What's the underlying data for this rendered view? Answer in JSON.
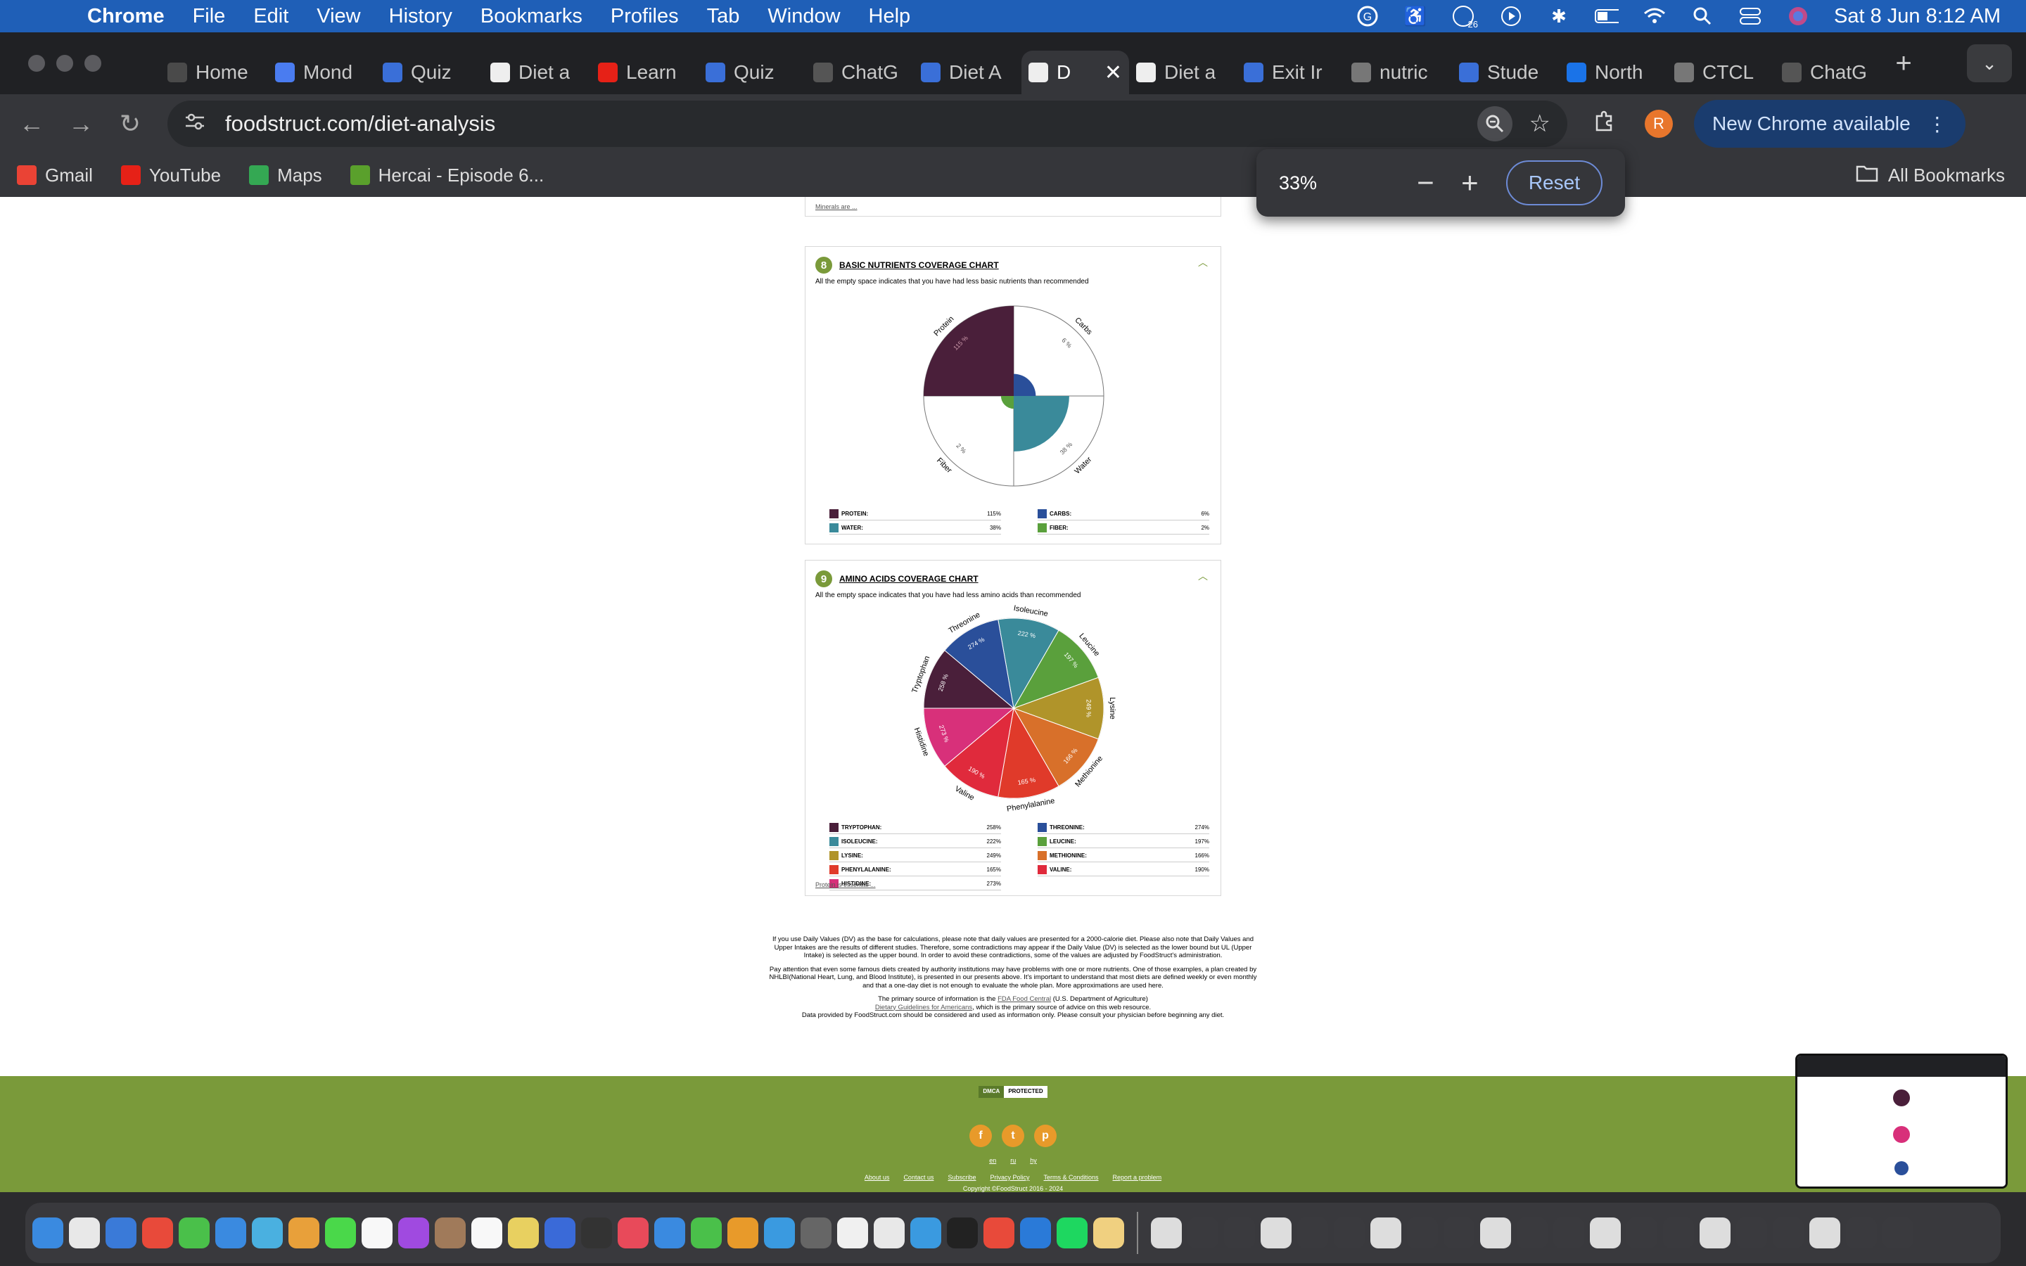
{
  "menubar": {
    "app": "Chrome",
    "items": [
      "File",
      "Edit",
      "View",
      "History",
      "Bookmarks",
      "Profiles",
      "Tab",
      "Window",
      "Help"
    ],
    "badge_count": "26",
    "datetime": "Sat 8 Jun  8:12 AM"
  },
  "tabs": [
    {
      "title": "Home",
      "color": "#4a4a4a",
      "icon": "home-icon",
      "active": false
    },
    {
      "title": "Mond",
      "color": "#4a7cf0",
      "icon": "docs-icon",
      "active": false
    },
    {
      "title": "Quiz",
      "color": "#3a6fd8",
      "icon": "quiz-icon",
      "active": false
    },
    {
      "title": "Diet a",
      "color": "#eeeeee",
      "icon": "foodstruct-icon",
      "active": false
    },
    {
      "title": "Learn",
      "color": "#e62117",
      "icon": "youtube-icon",
      "active": false
    },
    {
      "title": "Quiz",
      "color": "#3a6fd8",
      "icon": "quiz-icon",
      "active": false
    },
    {
      "title": "ChatG",
      "color": "#555555",
      "icon": "chatgpt-icon",
      "active": false
    },
    {
      "title": "Diet A",
      "color": "#3a6fd8",
      "icon": "quiz-icon",
      "active": false
    },
    {
      "title": "D",
      "color": "#eeeeee",
      "icon": "foodstruct-icon",
      "active": true
    },
    {
      "title": "Diet a",
      "color": "#eeeeee",
      "icon": "foodstruct-icon",
      "active": false
    },
    {
      "title": "Exit Ir",
      "color": "#3a6fd8",
      "icon": "quiz-icon",
      "active": false
    },
    {
      "title": "nutric",
      "color": "#777777",
      "icon": "globe-icon",
      "active": false
    },
    {
      "title": "Stude",
      "color": "#3a6fd8",
      "icon": "quiz-icon",
      "active": false
    },
    {
      "title": "North",
      "color": "#1a73e8",
      "icon": "loading-icon",
      "active": false
    },
    {
      "title": "CTCL",
      "color": "#777777",
      "icon": "globe-icon",
      "active": false
    },
    {
      "title": "ChatG",
      "color": "#555555",
      "icon": "chatgpt-icon",
      "active": false
    }
  ],
  "toolbar": {
    "url": "foodstruct.com/diet-analysis",
    "avatar_letter": "R",
    "new_chrome": "New Chrome available"
  },
  "bookmarks": [
    {
      "label": "Gmail",
      "icon": "gmail-icon",
      "color": "#ea4335"
    },
    {
      "label": "YouTube",
      "icon": "youtube-icon",
      "color": "#e62117"
    },
    {
      "label": "Maps",
      "icon": "maps-icon",
      "color": "#34a853"
    },
    {
      "label": "Hercai - Episode 6...",
      "icon": "play-icon",
      "color": "#5aa02c"
    }
  ],
  "all_bookmarks": "All Bookmarks",
  "zoom": {
    "value": "33%",
    "reset": "Reset"
  },
  "page": {
    "top_link": "Minerals are ...",
    "basic": {
      "number": "8",
      "title": "BASIC NUTRIENTS COVERAGE CHART",
      "subtitle": "All the empty space indicates that you have had less basic nutrients than recommended",
      "legend": [
        {
          "name": "PROTEIN:",
          "value": "115%",
          "color": "#4a1f3a"
        },
        {
          "name": "CARBS:",
          "value": "6%",
          "color": "#2a4f9a"
        },
        {
          "name": "WATER:",
          "value": "38%",
          "color": "#3a8a9a"
        },
        {
          "name": "FIBER:",
          "value": "2%",
          "color": "#5aa03c"
        }
      ]
    },
    "amino": {
      "number": "9",
      "title": "AMINO ACIDS COVERAGE CHART",
      "subtitle": "All the empty space indicates that you have had less amino acids than recommended",
      "legend": [
        {
          "name": "TRYPTOPHAN:",
          "value": "258%",
          "color": "#4a1f3a"
        },
        {
          "name": "THREONINE:",
          "value": "274%",
          "color": "#2a4f9a"
        },
        {
          "name": "ISOLEUCINE:",
          "value": "222%",
          "color": "#3a8a9a"
        },
        {
          "name": "LEUCINE:",
          "value": "197%",
          "color": "#5aa03c"
        },
        {
          "name": "LYSINE:",
          "value": "249%",
          "color": "#b0942a"
        },
        {
          "name": "METHIONINE:",
          "value": "166%",
          "color": "#d8702a"
        },
        {
          "name": "PHENYLALANINE:",
          "value": "165%",
          "color": "#e03a2a"
        },
        {
          "name": "VALINE:",
          "value": "190%",
          "color": "#e02a3c"
        },
        {
          "name": "HISTIDINE:",
          "value": "273%",
          "color": "#d8307a"
        }
      ],
      "link": "Protein is essential ..."
    },
    "disclaimer": {
      "p1": "If you use Daily Values (DV) as the base for calculations, please note that daily values are presented for a 2000-calorie diet. Please also note that Daily Values and Upper Intakes are the results of different studies. Therefore, some contradictions may appear if the Daily Value (DV) is selected as the lower bound but UL (Upper Intake) is selected as the upper bound. In order to avoid these contradictions, some of the values are adjusted by FoodStruct's administration.",
      "p2": "Pay attention that even some famous diets created by authority institutions may have problems with one or more nutrients. One of those examples, a plan created by NHLBI(National Heart, Lung, and Blood Institute), is presented in our presents above. It's important to understand that most diets are defined weekly or even monthly and that a one-day diet is not enough to evaluate the whole plan. More approximations are used here.",
      "p3a": "The primary source of information is the ",
      "p3link": "FDA Food Central",
      "p3b": " (U.S. Department of Agriculture)",
      "p4link": "Dietary Guidelines for Americans",
      "p4b": ", which is the primary source of advice on this web resource.",
      "p5": "Data provided by FoodStruct.com should be considered and used as information only. Please consult your physician before beginning any diet."
    },
    "footer": {
      "dmca": [
        "DMCA",
        "PROTECTED"
      ],
      "social": [
        "f",
        "t",
        "p"
      ],
      "langs": [
        "en",
        "ru",
        "hy"
      ],
      "links": [
        "About us",
        "Contact us",
        "Subscribe",
        "Privacy Policy",
        "Terms & Conditions",
        "Report a problem"
      ],
      "copyright": "Copyright ©FoodStruct 2016 - 2024"
    }
  },
  "chart_data": [
    {
      "type": "pie",
      "title": "BASIC NUTRIENTS COVERAGE CHART",
      "categories": [
        "Protein",
        "Carbs",
        "Water",
        "Fiber"
      ],
      "values": [
        115,
        6,
        38,
        2
      ],
      "unit": "%"
    },
    {
      "type": "pie",
      "title": "AMINO ACIDS COVERAGE CHART",
      "categories": [
        "Isoleucine",
        "Leucine",
        "Lysine",
        "Methionine",
        "Phenylalanine",
        "Valine",
        "Histidine",
        "Tryptophan",
        "Threonine"
      ],
      "values": [
        222,
        197,
        249,
        166,
        165,
        190,
        273,
        258,
        274
      ],
      "unit": "%"
    }
  ]
}
